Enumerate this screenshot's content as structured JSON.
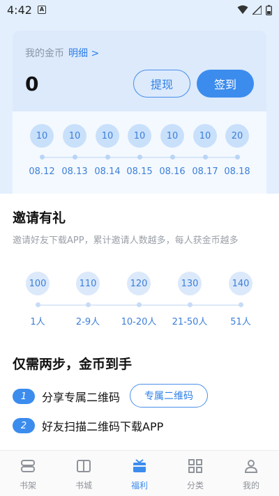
{
  "status_bar": {
    "time": "4:42",
    "badge": "A"
  },
  "coins": {
    "title": "我的金币",
    "detail_link": "明细 >",
    "amount": "0",
    "withdraw_label": "提现",
    "signin_label": "签到",
    "days": [
      {
        "value": "10",
        "date": "08.12"
      },
      {
        "value": "10",
        "date": "08.13"
      },
      {
        "value": "10",
        "date": "08.14"
      },
      {
        "value": "10",
        "date": "08.15"
      },
      {
        "value": "10",
        "date": "08.16"
      },
      {
        "value": "10",
        "date": "08.17"
      },
      {
        "value": "20",
        "date": "08.18"
      }
    ]
  },
  "invite": {
    "title": "邀请有礼",
    "subtitle": "邀请好友下载APP，累计邀请人数越多，每人获金币越多",
    "tiers": [
      {
        "value": "100",
        "label": "1人"
      },
      {
        "value": "110",
        "label": "2-9人"
      },
      {
        "value": "120",
        "label": "10-20人"
      },
      {
        "value": "130",
        "label": "21-50人"
      },
      {
        "value": "140",
        "label": "51人"
      }
    ]
  },
  "steps": {
    "title": "仅需两步，金币到手",
    "items": [
      {
        "num": "1",
        "text": "分享专属二维码"
      },
      {
        "num": "2",
        "text": "好友扫描二维码下载APP"
      }
    ],
    "qr_button": "专属二维码"
  },
  "nav": {
    "items": [
      {
        "label": "书架",
        "icon": "bookshelf-icon"
      },
      {
        "label": "书城",
        "icon": "book-icon"
      },
      {
        "label": "福利",
        "icon": "gift-icon",
        "active": true
      },
      {
        "label": "分类",
        "icon": "grid-icon"
      },
      {
        "label": "我的",
        "icon": "person-icon"
      }
    ]
  },
  "colors": {
    "accent": "#3c8cee",
    "header_bg": "#e3effd"
  }
}
